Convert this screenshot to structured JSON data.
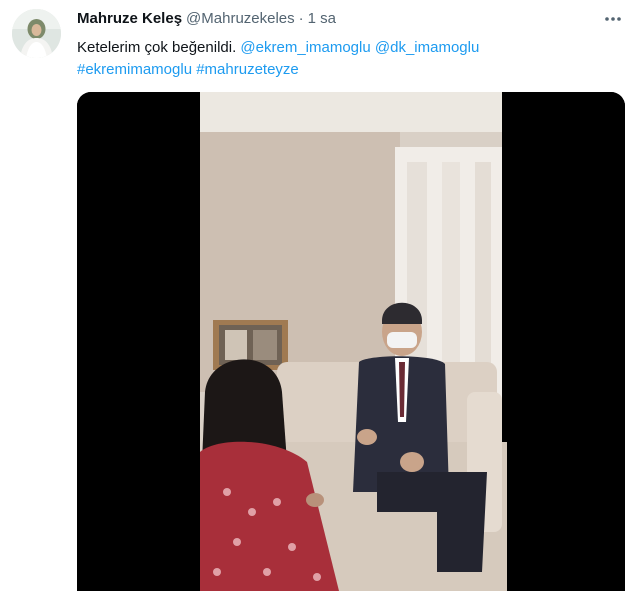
{
  "tweet": {
    "display_name": "Mahruze Keleş",
    "handle": "@Mahruzekeles",
    "separator": "·",
    "time": "1 sa",
    "more_icon": "more-options-icon",
    "text_prefix": "Ketelerim çok beğenildi. ",
    "mentions": [
      "@ekrem_imamoglu",
      "@dk_imamoglu"
    ],
    "hashtags": [
      "#ekremimamoglu",
      "#mahruzeteyze"
    ],
    "link_color": "#1d9bf0"
  }
}
